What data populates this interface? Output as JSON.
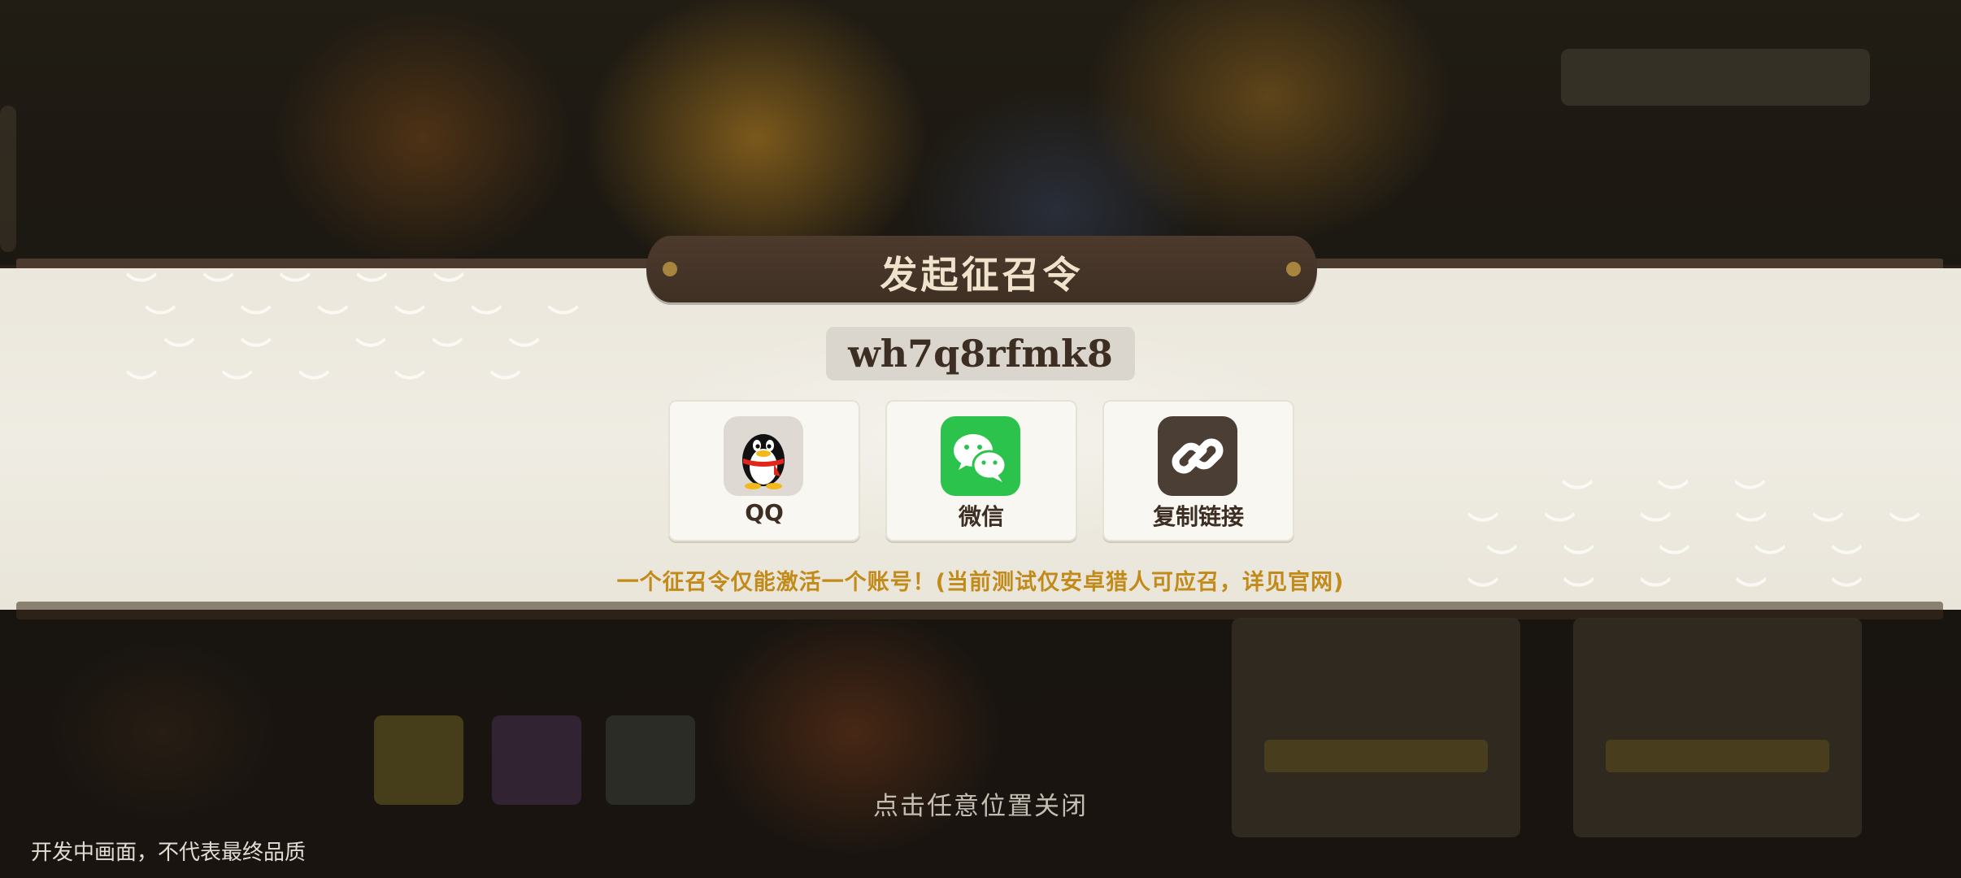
{
  "dialog": {
    "title": "发起征召令",
    "code": "wh7q8rfmk8",
    "share_options": [
      {
        "label": "QQ",
        "icon": "qq-penguin-icon"
      },
      {
        "label": "微信",
        "icon": "wechat-icon"
      },
      {
        "label": "复制链接",
        "icon": "link-icon"
      }
    ],
    "notice": "一个征召令仅能激活一个账号！(当前测试仅安卓猎人可应召，详见官网)"
  },
  "close_hint": "点击任意位置关闭",
  "disclaimer": "开发中画面，不代表最终品质",
  "colors": {
    "banner": "#ebe7dc",
    "plaque": "#4c3a2c",
    "notice": "#c28a18",
    "wechat_green": "#2bc34b",
    "link_brown": "#4a3e35"
  }
}
